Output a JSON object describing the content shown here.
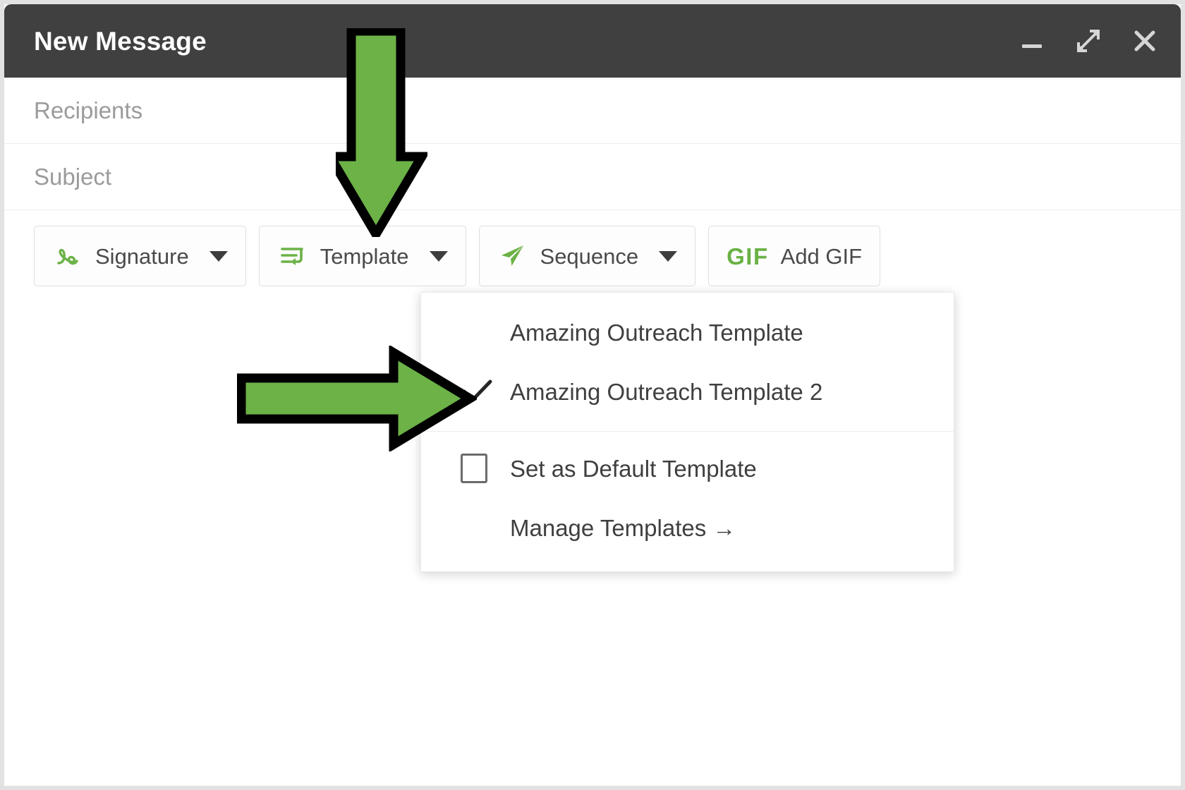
{
  "window": {
    "title": "New Message",
    "controls": [
      {
        "name": "minimize",
        "icon": "minimize-icon",
        "label": "Minimize"
      },
      {
        "name": "expand",
        "icon": "expand-icon",
        "label": "Expand"
      },
      {
        "name": "close",
        "icon": "close-icon",
        "label": "Close"
      }
    ]
  },
  "fields": [
    {
      "name": "recipients",
      "placeholder": "Recipients",
      "value": ""
    },
    {
      "name": "subject",
      "placeholder": "Subject",
      "value": ""
    }
  ],
  "toolbar": {
    "signature": {
      "label": "Signature",
      "icon": "signature-icon",
      "caret": true
    },
    "template": {
      "label": "Template",
      "icon": "template-icon",
      "caret": true
    },
    "sequence": {
      "label": "Sequence",
      "icon": "paper-plane-icon",
      "caret": true
    },
    "add_gif": {
      "label": "Add GIF",
      "icon": "gif-icon",
      "mark": "GIF",
      "caret": false
    }
  },
  "template_menu": {
    "templates": [
      {
        "label": "Amazing Outreach Template",
        "selected": false
      },
      {
        "label": "Amazing Outreach Template 2",
        "selected": true
      }
    ],
    "set_default": {
      "label": "Set as Default Template",
      "checked": false
    },
    "manage": {
      "label": "Manage Templates →"
    }
  },
  "annotations": [
    {
      "name": "arrow-down-annotation",
      "points_to": "Template",
      "color": "#6cb247",
      "outline": "#000000"
    },
    {
      "name": "arrow-right-annotation",
      "points_to": "Amazing Outreach Template 2",
      "color": "#6cb247",
      "outline": "#000000"
    }
  ],
  "colors": {
    "titlebar": "#404040",
    "accent_green": "#6cb247",
    "icon_green": "#69b145",
    "text": "#3f3f3f",
    "placeholder": "#9b9b9b",
    "frame_border": "#e2e2e2"
  }
}
